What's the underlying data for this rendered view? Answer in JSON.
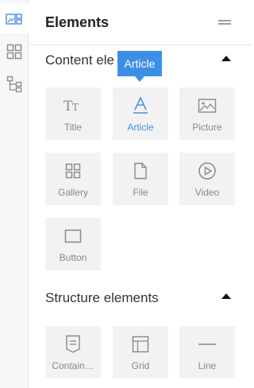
{
  "panel": {
    "title": "Elements",
    "menu_icon": "hamburger-icon"
  },
  "left_rail": {
    "items": [
      {
        "name": "elements",
        "icon": "elements-icon",
        "active": true
      },
      {
        "name": "layout",
        "icon": "layout-grid-icon",
        "active": false
      },
      {
        "name": "structure",
        "icon": "tree-icon",
        "active": false
      }
    ]
  },
  "tooltip": {
    "text": "Article"
  },
  "sections": {
    "content": {
      "title": "Content ele",
      "collapse_icon": "caret-up-icon",
      "tiles": [
        {
          "label": "Title",
          "icon": "title-icon",
          "active": false
        },
        {
          "label": "Article",
          "icon": "article-icon",
          "active": true
        },
        {
          "label": "Picture",
          "icon": "picture-icon",
          "active": false
        },
        {
          "label": "Gallery",
          "icon": "gallery-icon",
          "active": false
        },
        {
          "label": "File",
          "icon": "file-icon",
          "active": false
        },
        {
          "label": "Video",
          "icon": "video-icon",
          "active": false
        },
        {
          "label": "Button",
          "icon": "button-icon",
          "active": false
        }
      ]
    },
    "structure": {
      "title": "Structure elements",
      "collapse_icon": "caret-up-icon",
      "tiles": [
        {
          "label": "Contain…",
          "icon": "container-icon",
          "active": false
        },
        {
          "label": "Grid",
          "icon": "grid-icon",
          "active": false
        },
        {
          "label": "Line",
          "icon": "line-icon",
          "active": false
        }
      ]
    }
  },
  "colors": {
    "accent": "#4a90e2",
    "tooltip_bg": "#3d8fe6",
    "tile_bg": "#f2f2f2",
    "icon_gray": "#888888"
  }
}
